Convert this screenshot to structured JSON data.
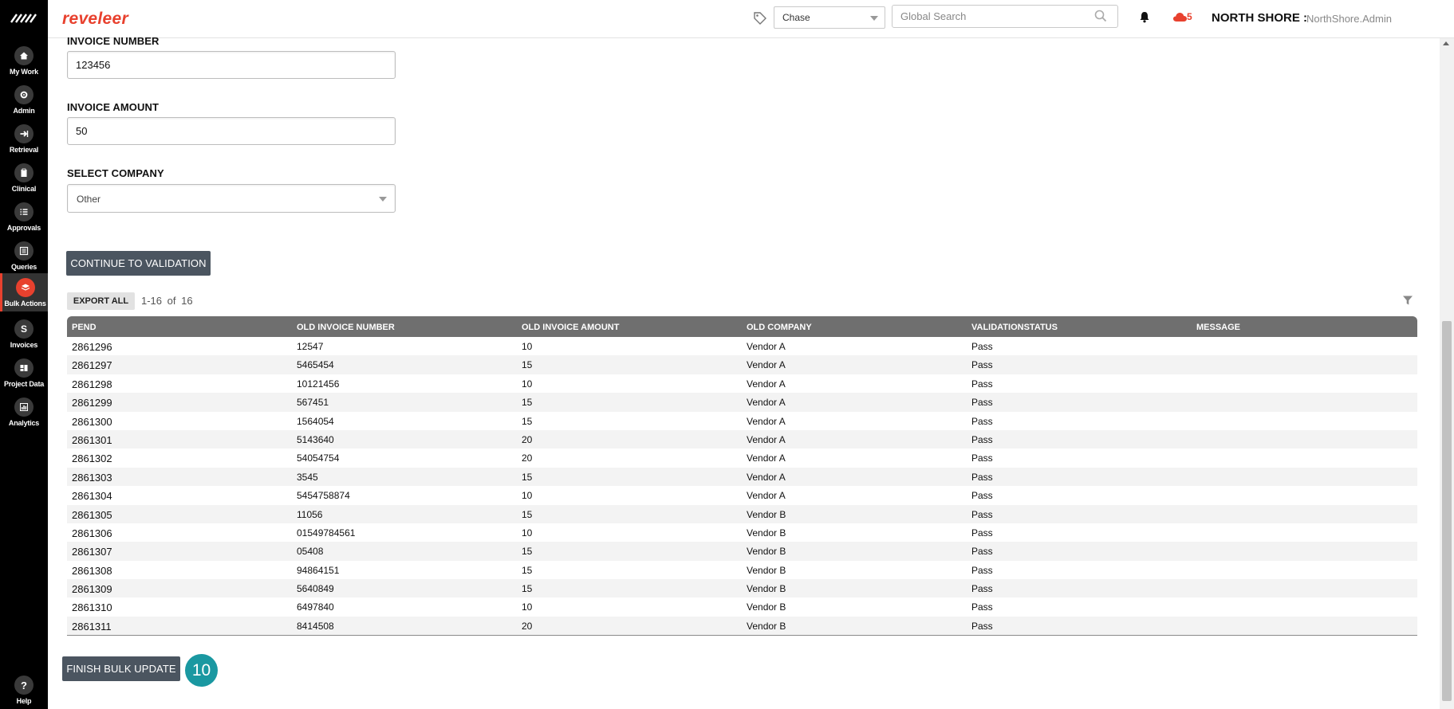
{
  "app": {
    "brand": "reveleer",
    "org": "NORTH SHORE :",
    "user": "NorthShore.Admin",
    "notification_count": "5",
    "accent": "#e8412e"
  },
  "header": {
    "project_select": "Chase",
    "search_placeholder": "Global Search"
  },
  "nav": {
    "items": [
      {
        "label": "My Work",
        "icon": "home-icon"
      },
      {
        "label": "Admin",
        "icon": "gear-icon"
      },
      {
        "label": "Retrieval",
        "icon": "arrow-in-icon"
      },
      {
        "label": "Clinical",
        "icon": "clipboard-icon"
      },
      {
        "label": "Approvals",
        "icon": "checklist-icon"
      },
      {
        "label": "Queries",
        "icon": "list-icon"
      },
      {
        "label": "Bulk Actions",
        "icon": "layers-icon"
      },
      {
        "label": "Invoices",
        "icon": "dollar-icon"
      },
      {
        "label": "Project Data",
        "icon": "folder-icon"
      },
      {
        "label": "Analytics",
        "icon": "bar-chart-icon"
      }
    ],
    "help": "Help"
  },
  "form": {
    "invoice_number_label": "INVOICE NUMBER",
    "invoice_number_value": "123456",
    "invoice_amount_label": "INVOICE AMOUNT",
    "invoice_amount_value": "50",
    "company_label": "SELECT COMPANY",
    "company_value": "Other",
    "continue_label": "CONTINUE TO VALIDATION"
  },
  "grid": {
    "export_label": "EXPORT ALL",
    "range": "1-16",
    "of": "of",
    "total": "16",
    "columns": [
      "PEND",
      "OLD INVOICE NUMBER",
      "OLD INVOICE AMOUNT",
      "OLD COMPANY",
      "VALIDATIONSTATUS",
      "MESSAGE"
    ],
    "rows": [
      [
        "2861296",
        "12547",
        "10",
        "Vendor A",
        "Pass",
        ""
      ],
      [
        "2861297",
        "5465454",
        "15",
        "Vendor A",
        "Pass",
        ""
      ],
      [
        "2861298",
        "10121456",
        "10",
        "Vendor A",
        "Pass",
        ""
      ],
      [
        "2861299",
        "567451",
        "15",
        "Vendor A",
        "Pass",
        ""
      ],
      [
        "2861300",
        "1564054",
        "15",
        "Vendor A",
        "Pass",
        ""
      ],
      [
        "2861301",
        "5143640",
        "20",
        "Vendor A",
        "Pass",
        ""
      ],
      [
        "2861302",
        "54054754",
        "20",
        "Vendor A",
        "Pass",
        ""
      ],
      [
        "2861303",
        "3545",
        "15",
        "Vendor A",
        "Pass",
        ""
      ],
      [
        "2861304",
        "5454758874",
        "10",
        "Vendor A",
        "Pass",
        ""
      ],
      [
        "2861305",
        "11056",
        "15",
        "Vendor B",
        "Pass",
        ""
      ],
      [
        "2861306",
        "01549784561",
        "10",
        "Vendor B",
        "Pass",
        ""
      ],
      [
        "2861307",
        "05408",
        "15",
        "Vendor B",
        "Pass",
        ""
      ],
      [
        "2861308",
        "94864151",
        "15",
        "Vendor B",
        "Pass",
        ""
      ],
      [
        "2861309",
        "5640849",
        "15",
        "Vendor B",
        "Pass",
        ""
      ],
      [
        "2861310",
        "6497840",
        "10",
        "Vendor B",
        "Pass",
        ""
      ],
      [
        "2861311",
        "8414508",
        "20",
        "Vendor B",
        "Pass",
        ""
      ]
    ]
  },
  "footer": {
    "finish_label": "FINISH BULK UPDATE",
    "step_number": "10"
  }
}
